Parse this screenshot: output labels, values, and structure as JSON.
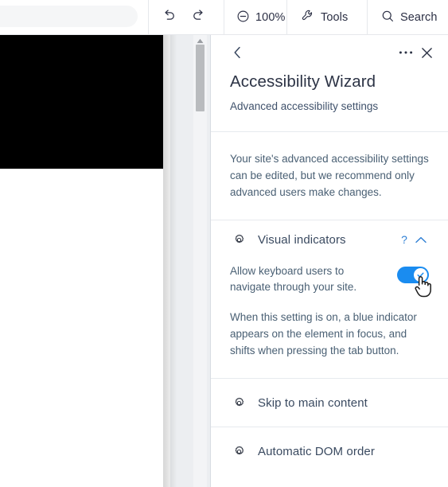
{
  "toolbar": {
    "omnibar_value": "",
    "undo_label": "Undo",
    "redo_label": "Redo",
    "zoom_label": "100%",
    "tools_label": "Tools",
    "search_label": "Search"
  },
  "panel": {
    "back_label": "Back",
    "more_label": "More options",
    "close_label": "Close",
    "title": "Accessibility Wizard",
    "subtitle": "Advanced accessibility settings",
    "note": "Your site's advanced accessibility settings can be edited, but we recommend only advanced users make changes.",
    "sections": [
      {
        "name": "Visual indicators",
        "expanded": true,
        "help_glyph": "?",
        "setting_label": "Allow keyboard users to navigate through your site.",
        "toggle_on": true,
        "description": "When this setting is on, a blue indicator appears on the element in focus, and shifts when pressing the tab button."
      },
      {
        "name": "Skip to main content",
        "expanded": false
      },
      {
        "name": "Automatic DOM order",
        "expanded": false
      }
    ]
  },
  "colors": {
    "accent_blue": "#1a8cf0",
    "link_blue": "#2e7fd4",
    "text_dark": "#2c3345",
    "text_muted": "#4a6074",
    "panel_border": "#d8dce2"
  },
  "icons": {
    "undo": "undo-icon",
    "redo": "redo-icon",
    "zoom_out": "zoom-out-icon",
    "tools": "wrench-icon",
    "search": "magnifier-icon",
    "back": "chevron-left-icon",
    "more": "ellipsis-icon",
    "close": "close-icon",
    "section": "gear-icon",
    "collapse": "chevron-up-icon",
    "toggle_check": "check-icon",
    "cursor": "hand-pointer-cursor",
    "scroll_up": "scroll-up-arrow-icon"
  }
}
